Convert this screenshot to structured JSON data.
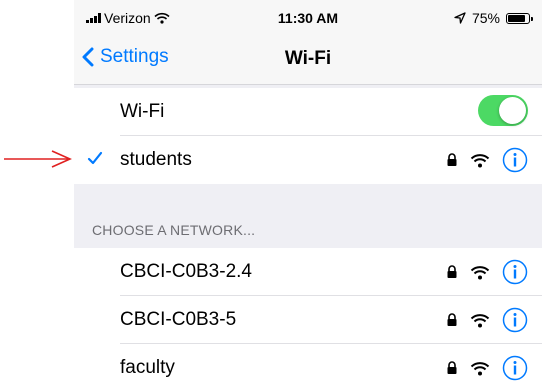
{
  "annotation": {
    "color": "#e02020",
    "icon": "red-arrow-icon"
  },
  "status_bar": {
    "carrier": "Verizon",
    "time": "11:30 AM",
    "battery": "75%"
  },
  "nav": {
    "back_label": "Settings",
    "title": "Wi-Fi"
  },
  "wifi_toggle": {
    "label": "Wi-Fi",
    "on": true,
    "color": "#4cd964"
  },
  "connected": {
    "name": "students"
  },
  "section_header": "CHOOSE A NETWORK...",
  "networks": [
    {
      "name": "CBCI-C0B3-2.4"
    },
    {
      "name": "CBCI-C0B3-5"
    },
    {
      "name": "faculty"
    }
  ],
  "colors": {
    "accent": "#007aff",
    "background": "#efeff4"
  }
}
